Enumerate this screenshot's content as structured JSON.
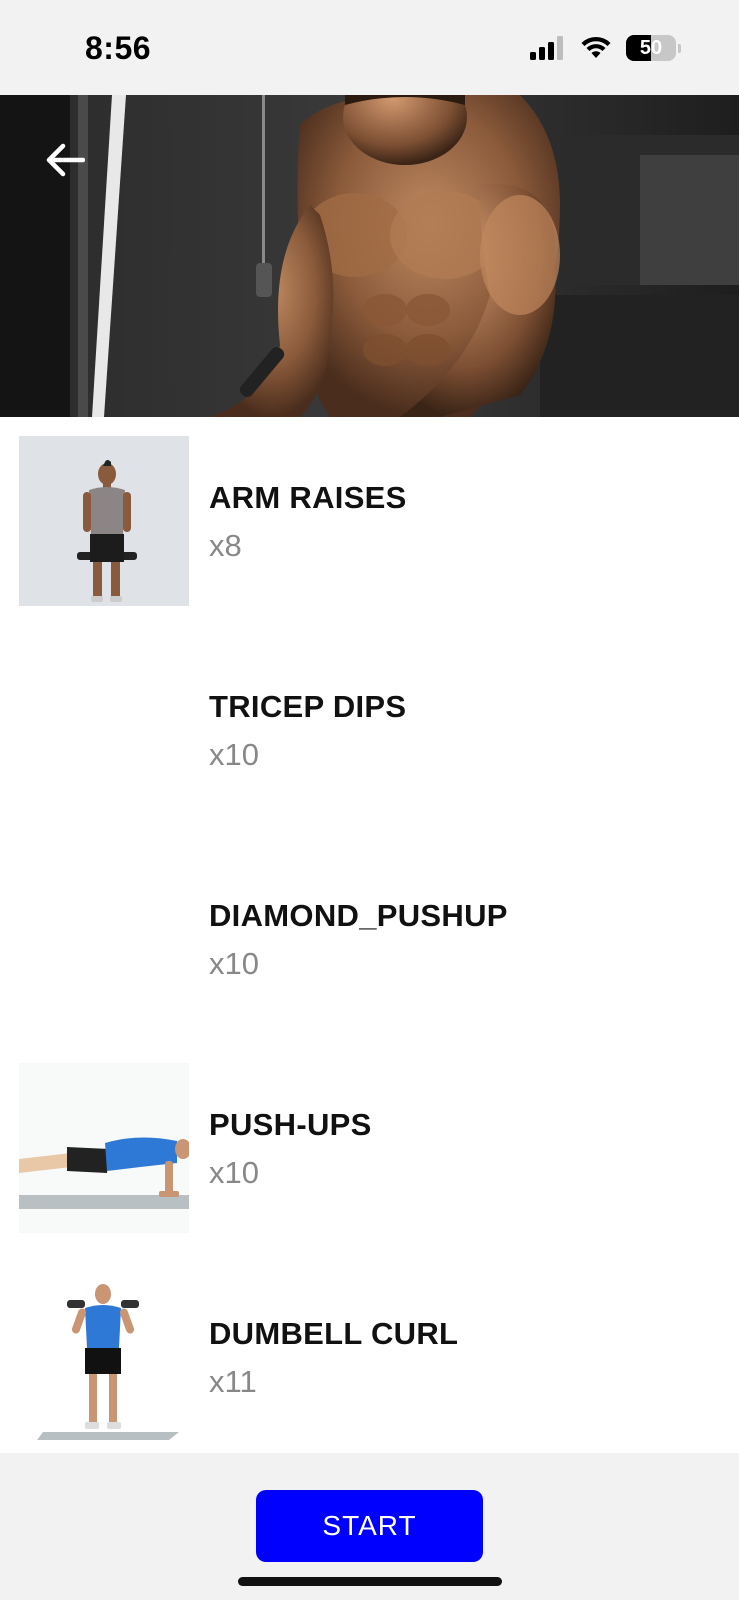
{
  "status_bar": {
    "time": "8:56",
    "battery": "50",
    "battery_level": 0.5
  },
  "header": {
    "back_icon": "arrow-left-icon"
  },
  "exercises": [
    {
      "name": "ARM RAISES",
      "reps": "x8",
      "thumbnail": "standing-dumbbells"
    },
    {
      "name": "TRICEP DIPS",
      "reps": "x10",
      "thumbnail": ""
    },
    {
      "name": "DIAMOND_PUSHUP",
      "reps": "x10",
      "thumbnail": ""
    },
    {
      "name": "PUSH-UPS",
      "reps": "x10",
      "thumbnail": "pushup"
    },
    {
      "name": "DUMBELL CURL",
      "reps": "x11",
      "thumbnail": "dumbbell-curl"
    }
  ],
  "footer": {
    "start_label": "START"
  },
  "colors": {
    "accent": "#0000ff",
    "status_bg": "#f2f2f2",
    "reps_text": "#888888"
  }
}
